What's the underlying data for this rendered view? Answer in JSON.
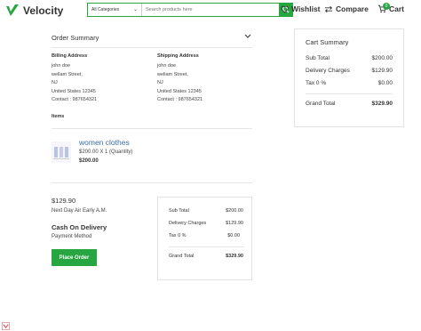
{
  "header": {
    "brand": "Velocity",
    "category_selected": "All Categories",
    "search_placeholder": "Search products here",
    "wishlist_label": "Wishlist",
    "compare_label": "Compare",
    "cart_label": "Cart",
    "cart_count": "0",
    "accent_color": "#26a541"
  },
  "order_summary": {
    "title": "Order Summary",
    "billing": {
      "heading": "Billing Address",
      "lines": [
        "john doe",
        "wellam Street,",
        "NJ",
        "United States 12345",
        "Contact : 987654321"
      ]
    },
    "shipping": {
      "heading": "Shipping Address",
      "lines": [
        "john doe",
        "wellam Street,",
        "NJ",
        "United States 12345",
        "Contact : 987654321"
      ]
    },
    "items_heading": "Items",
    "item": {
      "name": "women clothes",
      "qty_line": "$200.00 X 1 (Quantity)",
      "price": "$200.00"
    },
    "shipping_price": "$129.90",
    "shipping_method": "Next Day Air Early A.M.",
    "payment_title": "Cash On Delivery",
    "payment_label": "Payment Method",
    "place_order": "Place Order",
    "totals": {
      "subtotal_label": "Sub Total",
      "subtotal": "$200.00",
      "delivery_label": "Delivery Charges",
      "delivery": "$129.90",
      "tax_label": "Tax 0 %",
      "tax": "$0.00",
      "grand_label": "Grand Total",
      "grand": "$329.90"
    }
  },
  "cart_summary": {
    "title": "Cart Summary",
    "subtotal_label": "Sub Total",
    "subtotal": "$200.00",
    "delivery_label": "Delivery Charges",
    "delivery": "$129.90",
    "tax_label": "Tax 0 %",
    "tax": "$0.00",
    "grand_label": "Grand Total",
    "grand": "$329.90"
  }
}
